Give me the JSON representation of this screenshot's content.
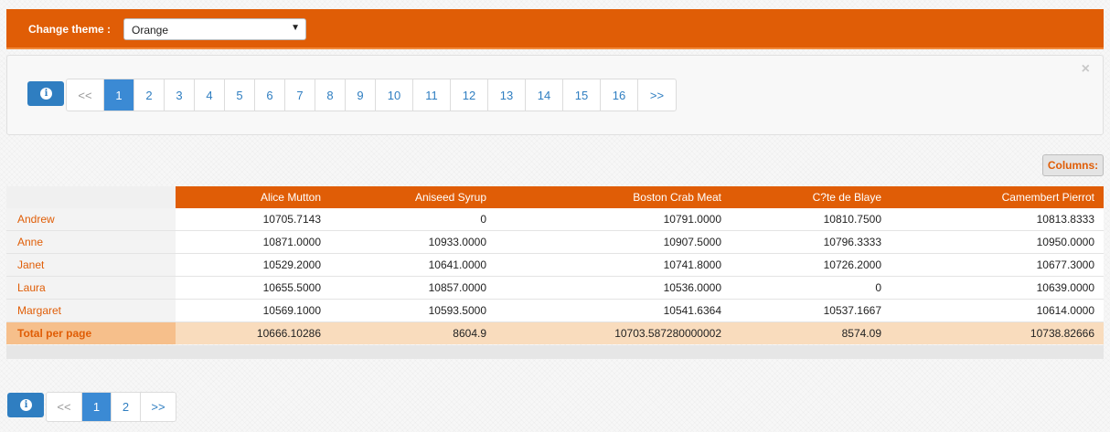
{
  "theme": {
    "label": "Change theme :",
    "selected": "Orange"
  },
  "top_pager": {
    "info_icon": "info-icon",
    "prev": "<<",
    "pages": [
      "1",
      "2",
      "3",
      "4",
      "5",
      "6",
      "7",
      "8",
      "9",
      "10",
      "11",
      "12",
      "13",
      "14",
      "15",
      "16"
    ],
    "next": ">>",
    "active": "1"
  },
  "panel_close": "×",
  "columns_button": "Columns:",
  "table": {
    "columns": [
      "Alice Mutton",
      "Aniseed Syrup",
      "Boston Crab Meat",
      "C?te de Blaye",
      "Camembert Pierrot"
    ],
    "rows": [
      {
        "name": "Andrew",
        "values": [
          "10705.7143",
          "0",
          "10791.0000",
          "10810.7500",
          "10813.8333"
        ]
      },
      {
        "name": "Anne",
        "values": [
          "10871.0000",
          "10933.0000",
          "10907.5000",
          "10796.3333",
          "10950.0000"
        ]
      },
      {
        "name": "Janet",
        "values": [
          "10529.2000",
          "10641.0000",
          "10741.8000",
          "10726.2000",
          "10677.3000"
        ]
      },
      {
        "name": "Laura",
        "values": [
          "10655.5000",
          "10857.0000",
          "10536.0000",
          "0",
          "10639.0000"
        ]
      },
      {
        "name": "Margaret",
        "values": [
          "10569.1000",
          "10593.5000",
          "10541.6364",
          "10537.1667",
          "10614.0000"
        ]
      }
    ],
    "total": {
      "name": "Total per page",
      "values": [
        "10666.10286",
        "8604.9",
        "10703.587280000002",
        "8574.09",
        "10738.82666"
      ]
    }
  },
  "bottom_pager": {
    "prev": "<<",
    "pages": [
      "1",
      "2"
    ],
    "next": ">>",
    "active": "1"
  },
  "colors": {
    "accent": "#e05d06",
    "pager_active": "#3b8ad4",
    "total_row": "#f9dcbd"
  }
}
